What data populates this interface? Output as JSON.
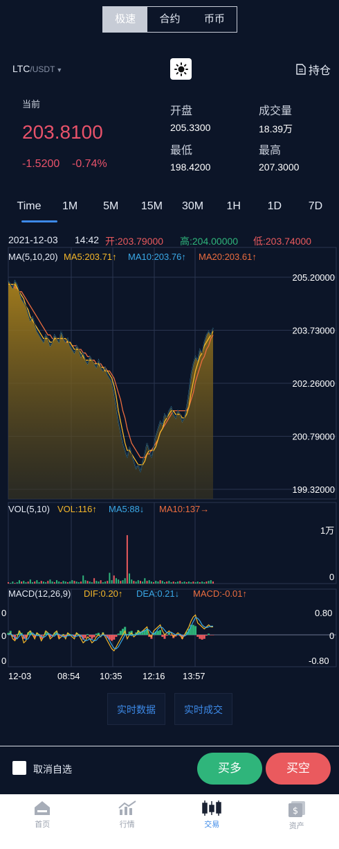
{
  "segment": {
    "tabs": [
      "极速",
      "合约",
      "币币"
    ],
    "active": 0
  },
  "header": {
    "pair_base": "LTC",
    "pair_quote": "/USDT",
    "theme_icon": "sun-icon",
    "holdings_label": "持仓",
    "holdings_icon": "document-icon"
  },
  "ticker": {
    "current_label": "当前",
    "price": "203.8100",
    "change": "-1.5200",
    "change_pct": "-0.74%",
    "open_label": "开盘",
    "open": "205.3300",
    "volume_label": "成交量",
    "volume": "18.39万",
    "low_label": "最低",
    "low": "198.4200",
    "high_label": "最高",
    "high": "207.3000"
  },
  "intervals": [
    "Time",
    "1M",
    "5M",
    "15M",
    "30M",
    "1H",
    "1D",
    "7D"
  ],
  "active_interval": 0,
  "ohlc": {
    "date": "2021-12-03",
    "time": "14:42",
    "open": "开:203.79000",
    "high": "高:204.00000",
    "low": "低:203.74000"
  },
  "ma": {
    "title": "MA(5,10,20)",
    "ma5": "MA5:203.71↑",
    "ma10": "MA10:203.76↑",
    "ma20": "MA20:203.61↑"
  },
  "vol": {
    "title": "VOL(5,10)",
    "vol": "VOL:116↑",
    "ma5": "MA5:88↓",
    "ma10": "MA10:137→",
    "top": "1万",
    "bottom": "0"
  },
  "macd": {
    "title": "MACD(12,26,9)",
    "dif": "DIF:0.20↑",
    "dea": "DEA:0.21↓",
    "macd": "MACD:-0.01↑",
    "top": "0.80",
    "mid": "0",
    "bot": "-0.80",
    "left_top": "0",
    "left_mid": "0",
    "left_bot": "0"
  },
  "chart_data": {
    "type": "area",
    "ylabel_ticks": [
      "205.20000",
      "203.73000",
      "202.26000",
      "200.79000",
      "199.32000"
    ],
    "ylim": [
      199.32,
      205.2
    ],
    "xticks": [
      "12-03",
      "08:54",
      "10:35",
      "12:16",
      "13:57"
    ],
    "price": [
      205.1,
      205.0,
      204.9,
      205.1,
      205.0,
      204.8,
      204.6,
      204.5,
      204.4,
      204.2,
      204.0,
      204.1,
      203.9,
      203.7,
      203.6,
      203.5,
      203.4,
      203.6,
      203.5,
      203.3,
      203.4,
      203.6,
      203.5,
      203.4,
      203.7,
      203.5,
      203.4,
      203.5,
      203.3,
      203.2,
      203.1,
      203.3,
      203.2,
      203.0,
      203.1,
      202.9,
      202.8,
      203.0,
      202.9,
      202.8,
      202.7,
      202.9,
      202.7,
      202.6,
      202.7,
      202.5,
      202.4,
      202.3,
      202.0,
      201.6,
      201.2,
      200.9,
      200.6,
      200.4,
      200.2,
      200.5,
      200.3,
      200.1,
      199.9,
      200.0,
      199.8,
      200.1,
      200.3,
      200.6,
      200.4,
      200.2,
      200.5,
      200.8,
      201.0,
      201.2,
      201.1,
      201.4,
      201.3,
      201.5,
      201.6,
      201.4,
      201.3,
      201.5,
      201.4,
      201.2,
      201.3,
      201.6,
      202.0,
      202.5,
      202.8,
      203.0,
      202.9,
      203.2,
      203.1,
      203.4,
      203.6,
      203.7,
      203.6,
      203.8
    ],
    "ma5": [
      205.0,
      205.0,
      205.0,
      205.0,
      204.9,
      204.8,
      204.7,
      204.6,
      204.4,
      204.3,
      204.1,
      204.0,
      203.9,
      203.8,
      203.7,
      203.6,
      203.5,
      203.5,
      203.5,
      203.4,
      203.4,
      203.5,
      203.5,
      203.5,
      203.5,
      203.5,
      203.5,
      203.4,
      203.4,
      203.3,
      203.2,
      203.2,
      203.2,
      203.1,
      203.0,
      202.9,
      202.9,
      202.9,
      202.9,
      202.8,
      202.8,
      202.8,
      202.7,
      202.7,
      202.6,
      202.6,
      202.5,
      202.4,
      202.2,
      201.9,
      201.5,
      201.2,
      200.9,
      200.6,
      200.4,
      200.4,
      200.3,
      200.2,
      200.1,
      200.0,
      200.0,
      200.0,
      200.1,
      200.3,
      200.4,
      200.4,
      200.4,
      200.5,
      200.7,
      200.9,
      201.0,
      201.2,
      201.3,
      201.4,
      201.5,
      201.5,
      201.4,
      201.4,
      201.4,
      201.3,
      201.3,
      201.4,
      201.6,
      202.0,
      202.3,
      202.6,
      202.8,
      203.0,
      203.1,
      203.3,
      203.4,
      203.5,
      203.6,
      203.7
    ],
    "ma20": [
      205.0,
      205.0,
      205.0,
      204.9,
      204.9,
      204.8,
      204.8,
      204.7,
      204.6,
      204.5,
      204.4,
      204.3,
      204.2,
      204.1,
      204.0,
      203.9,
      203.8,
      203.7,
      203.6,
      203.6,
      203.5,
      203.5,
      203.5,
      203.5,
      203.5,
      203.5,
      203.4,
      203.4,
      203.4,
      203.3,
      203.3,
      203.3,
      203.2,
      203.2,
      203.1,
      203.1,
      203.0,
      203.0,
      202.9,
      202.9,
      202.8,
      202.8,
      202.8,
      202.7,
      202.7,
      202.6,
      202.6,
      202.5,
      202.4,
      202.2,
      202.0,
      201.8,
      201.5,
      201.3,
      201.0,
      200.8,
      200.6,
      200.5,
      200.4,
      200.3,
      200.2,
      200.2,
      200.2,
      200.3,
      200.3,
      200.4,
      200.5,
      200.6,
      200.7,
      200.9,
      201.0,
      201.1,
      201.2,
      201.3,
      201.4,
      201.5,
      201.5,
      201.5,
      201.5,
      201.5,
      201.5,
      201.5,
      201.6,
      201.8,
      202.0,
      202.3,
      202.5,
      202.7,
      202.9,
      203.0,
      203.2,
      203.3,
      203.5,
      203.6
    ],
    "volume": [
      0.02,
      0.01,
      0.03,
      0.01,
      0.02,
      0.05,
      0.03,
      0.04,
      0.02,
      0.03,
      0.06,
      0.02,
      0.03,
      0.05,
      0.02,
      0.04,
      0.03,
      0.02,
      0.04,
      0.06,
      0.03,
      0.02,
      0.05,
      0.03,
      0.02,
      0.04,
      0.03,
      0.02,
      0.03,
      0.05,
      0.04,
      0.03,
      0.02,
      0.03,
      0.12,
      0.05,
      0.04,
      0.03,
      0.02,
      0.08,
      0.04,
      0.03,
      0.05,
      0.02,
      0.03,
      0.04,
      0.16,
      0.05,
      0.12,
      0.08,
      0.06,
      0.04,
      0.05,
      0.08,
      0.72,
      0.15,
      0.06,
      0.04,
      0.03,
      0.05,
      0.04,
      0.03,
      0.08,
      0.04,
      0.05,
      0.03,
      0.02,
      0.04,
      0.03,
      0.05,
      0.04,
      0.02,
      0.03,
      0.04,
      0.02,
      0.03,
      0.02,
      0.03,
      0.04,
      0.02,
      0.03,
      0.02,
      0.03,
      0.02,
      0.03,
      0.02,
      0.03,
      0.02,
      0.03,
      0.02,
      0.03,
      0.04,
      0.05,
      0.03
    ],
    "macd_dif": [
      0.0,
      0.05,
      -0.1,
      -0.15,
      -0.05,
      0.1,
      0.0,
      -0.2,
      -0.15,
      0.05,
      0.1,
      0.0,
      -0.1,
      0.05,
      0.0,
      -0.15,
      -0.05,
      0.1,
      0.05,
      -0.1,
      -0.05,
      0.05,
      0.1,
      -0.1,
      -0.05,
      0.0,
      -0.1,
      0.05,
      0.0,
      -0.05,
      -0.1,
      0.05,
      0.0,
      -0.1,
      -0.2,
      -0.15,
      -0.05,
      -0.1,
      -0.2,
      -0.15,
      -0.05,
      0.0,
      -0.05,
      0.05,
      -0.05,
      -0.15,
      -0.25,
      -0.35,
      -0.4,
      -0.3,
      -0.2,
      -0.1,
      0.0,
      0.1,
      -0.1,
      0.0,
      0.05,
      -0.05,
      0.0,
      0.1,
      0.05,
      0.1,
      0.15,
      0.2,
      0.0,
      -0.05,
      0.1,
      0.15,
      0.2,
      0.25,
      0.1,
      0.0,
      0.05,
      0.1,
      0.05,
      -0.05,
      0.0,
      0.05,
      0.0,
      -0.1,
      0.0,
      0.1,
      0.2,
      0.35,
      0.45,
      0.5,
      0.3,
      0.25,
      0.2,
      0.15,
      0.2,
      0.25,
      0.2,
      0.2
    ],
    "macd_hist": [
      0.05,
      0.1,
      -0.05,
      -0.12,
      0.02,
      0.1,
      0.05,
      -0.1,
      -0.08,
      0.06,
      0.1,
      0.02,
      -0.06,
      0.05,
      0.02,
      -0.1,
      -0.02,
      0.08,
      0.05,
      -0.06,
      -0.02,
      0.05,
      0.08,
      -0.08,
      -0.03,
      0.02,
      -0.05,
      0.04,
      0.02,
      -0.02,
      -0.05,
      0.05,
      0.02,
      -0.05,
      -0.12,
      -0.08,
      0.02,
      -0.05,
      -0.1,
      -0.06,
      0.03,
      0.05,
      0.0,
      0.06,
      -0.02,
      -0.08,
      -0.12,
      -0.15,
      -0.12,
      -0.05,
      0.03,
      0.1,
      0.15,
      0.2,
      0.02,
      0.08,
      0.1,
      0.02,
      0.06,
      0.12,
      0.08,
      0.1,
      0.12,
      0.15,
      -0.05,
      -0.1,
      0.05,
      0.08,
      0.1,
      0.12,
      -0.05,
      -0.1,
      -0.02,
      0.05,
      -0.02,
      -0.08,
      -0.04,
      0.02,
      -0.03,
      -0.1,
      -0.02,
      0.08,
      0.15,
      0.25,
      0.25,
      0.22,
      -0.05,
      -0.1,
      -0.12,
      -0.1,
      -0.02,
      0.03,
      -0.01,
      -0.01
    ]
  },
  "actions": {
    "realtime_data": "实时数据",
    "realtime_trades": "实时成交"
  },
  "bottom": {
    "unfavorite": "取消自选",
    "long": "买多",
    "short": "买空"
  },
  "nav": [
    {
      "label": "首页",
      "icon": "home-icon"
    },
    {
      "label": "行情",
      "icon": "market-chart-icon"
    },
    {
      "label": "交易",
      "icon": "candlestick-icon"
    },
    {
      "label": "资产",
      "icon": "wallet-icon"
    }
  ],
  "colors": {
    "up": "#2fb57b",
    "down": "#ea5a5e",
    "accent": "#3d8ae8",
    "ma5": "#f5b72a",
    "ma10": "#3aa9e8",
    "ma20": "#ec6d3f"
  }
}
